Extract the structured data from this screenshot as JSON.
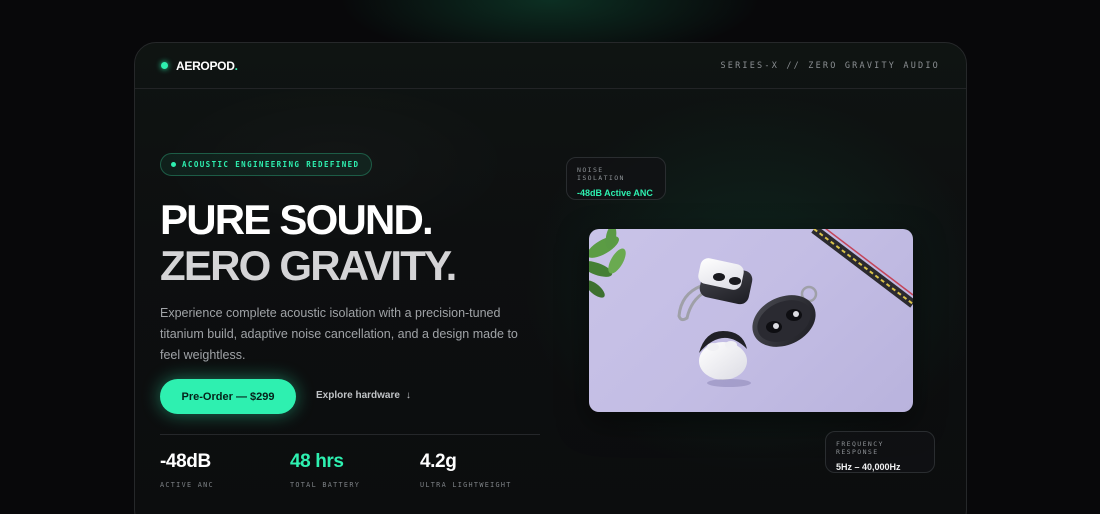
{
  "brand": {
    "name": "AEROPOD",
    "suffix": ".",
    "accent": "#2ef0b0"
  },
  "nav": {
    "tagline": "SERIES-X // ZERO GRAVITY AUDIO"
  },
  "hero": {
    "badge": "ACOUSTIC ENGINEERING REDEFINED",
    "headline_line1": "PURE SOUND.",
    "headline_line2": "ZERO GRAVITY.",
    "description": "Experience complete acoustic isolation with a precision-tuned titanium build, adaptive noise cancellation, and a design made to feel weightless.",
    "cta_label": "Pre-Order — $299",
    "secondary_label": "Explore hardware",
    "secondary_icon": "arrow-down-icon"
  },
  "stats": [
    {
      "value": "-48dB",
      "label": "ACTIVE ANC"
    },
    {
      "value": "48 hrs",
      "label": "TOTAL BATTERY"
    },
    {
      "value": "4.2g",
      "label": "ULTRA LIGHTWEIGHT"
    }
  ],
  "float_cards": {
    "noise": {
      "label": "NOISE ISOLATION",
      "value": "-48dB Active ANC"
    },
    "frequency": {
      "label": "FREQUENCY RESPONSE",
      "value": "5Hz – 40,000Hz"
    }
  }
}
